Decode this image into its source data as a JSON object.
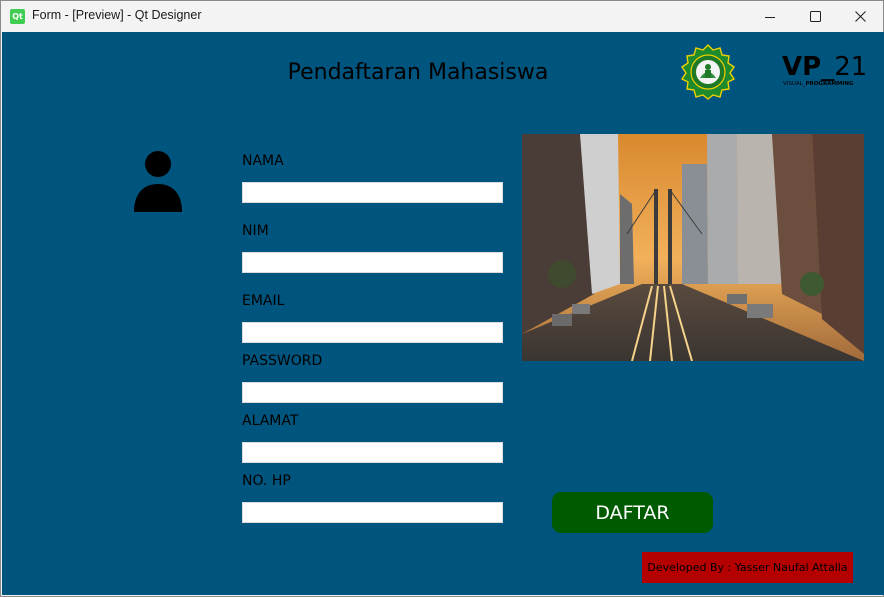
{
  "window": {
    "title": "Form - [Preview] - Qt Designer",
    "app_icon_text": "Qt"
  },
  "form": {
    "heading": "Pendaftaran Mahasiswa",
    "fields": [
      {
        "label": "NAMA",
        "value": ""
      },
      {
        "label": "NIM",
        "value": ""
      },
      {
        "label": "EMAIL",
        "value": ""
      },
      {
        "label": "PASSWORD",
        "value": ""
      },
      {
        "label": "ALAMAT",
        "value": ""
      },
      {
        "label": "NO. HP",
        "value": ""
      }
    ],
    "submit_label": "DAFTAR",
    "developer_credit": "Developed By : Yasser Naufal Attalla"
  },
  "logos": {
    "vp_main_bold": "VP",
    "vp_main_rest": "_21",
    "vp_sub_regular": "VISUAL_",
    "vp_sub_bold": "PROGRAMMING"
  },
  "icons": {
    "app": "qt-logo-icon",
    "minimize": "minimize-icon",
    "maximize": "maximize-icon",
    "close": "close-icon",
    "user": "user-avatar-icon",
    "seal": "university-seal-logo"
  },
  "colors": {
    "form_background": "#00557f",
    "button_green": "#005a00",
    "credit_red": "#b40000",
    "titlebar": "#f3f3f3"
  }
}
